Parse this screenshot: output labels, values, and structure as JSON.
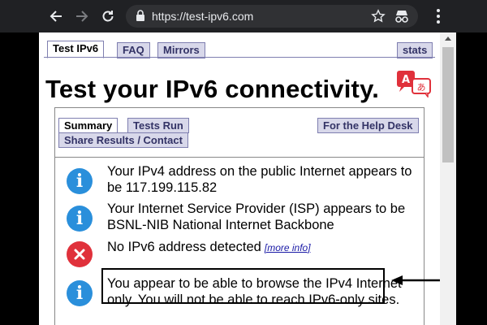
{
  "browser": {
    "url": "https://test-ipv6.com",
    "colors": {
      "chrome": "#202124",
      "omnibox": "#303134"
    }
  },
  "tabs": [
    {
      "label": "Test IPv6",
      "active": true
    },
    {
      "label": "FAQ",
      "active": false
    },
    {
      "label": "Mirrors",
      "active": false
    },
    {
      "label": "stats",
      "active": false
    }
  ],
  "page": {
    "title": "Test your IPv6 connectivity."
  },
  "inner_tabs": [
    {
      "label": "Summary",
      "active": true
    },
    {
      "label": "Tests Run",
      "active": false
    },
    {
      "label": "For the Help Desk",
      "active": false
    },
    {
      "label": "Share Results / Contact",
      "active": false
    }
  ],
  "results": [
    {
      "icon": "info-icon",
      "text": "Your IPv4 address on the public Internet appears to be 117.199.115.82"
    },
    {
      "icon": "info-icon",
      "text": "Your Internet Service Provider (ISP) appears to be BSNL-NIB National Internet Backbone"
    },
    {
      "icon": "error-icon",
      "text": "No IPv6 address detected",
      "link": "[more info]"
    },
    {
      "icon": "info-icon",
      "text": "You appear to be able to browse the IPv4 Internet only. You will not be able to reach IPv6-only sites."
    }
  ],
  "colors": {
    "info": "#2a8fdb",
    "error": "#e0313b",
    "tab_bg": "#d8d8ea",
    "tab_text": "#333366"
  }
}
